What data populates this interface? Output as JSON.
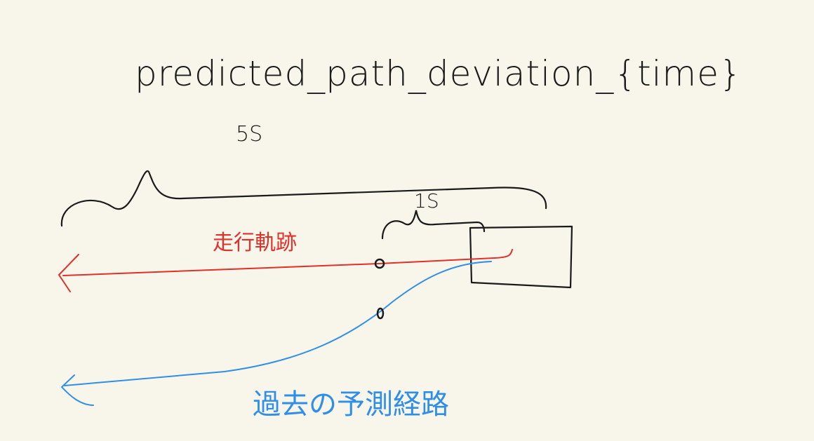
{
  "title": "predicted_path_deviation_{time}",
  "labels": {
    "long_span": "5S",
    "short_span": "1S",
    "driving_trajectory": "走行軌跡",
    "past_predicted_path": "過去の予測経路"
  },
  "colors": {
    "background": "#f8f6ea",
    "ink": "#1a1a1a",
    "trajectory": "#e0302a",
    "predicted": "#2f8fe8"
  }
}
